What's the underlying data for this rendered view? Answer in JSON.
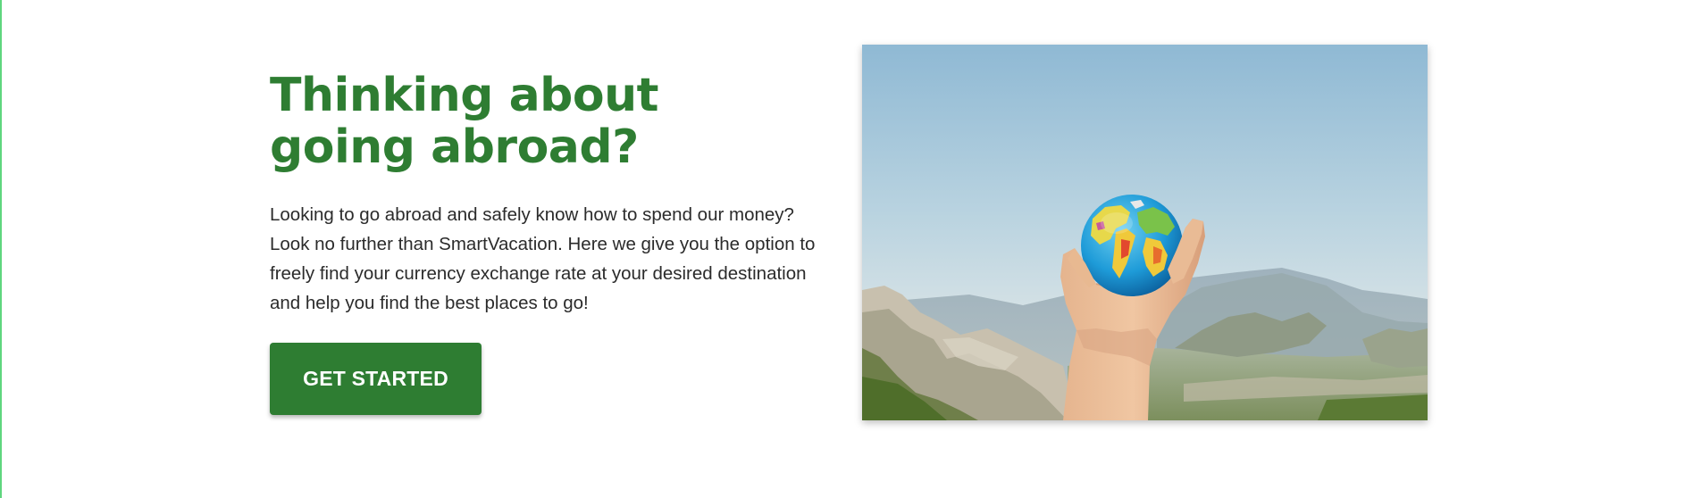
{
  "hero": {
    "headline": "Thinking about going abroad?",
    "description": "Looking to go abroad and safely know how to spend our money? Look no further than SmartVacation. Here we give you the option to freely find your currency exchange rate at your desired destination and help you find the best places to go!",
    "cta_label": "GET STARTED"
  },
  "colors": {
    "brand_green": "#2e7d32",
    "text": "#2b2b2b",
    "left_border_accent": "#5fd67e"
  },
  "image": {
    "subject": "hand-holding-globe-icon"
  }
}
